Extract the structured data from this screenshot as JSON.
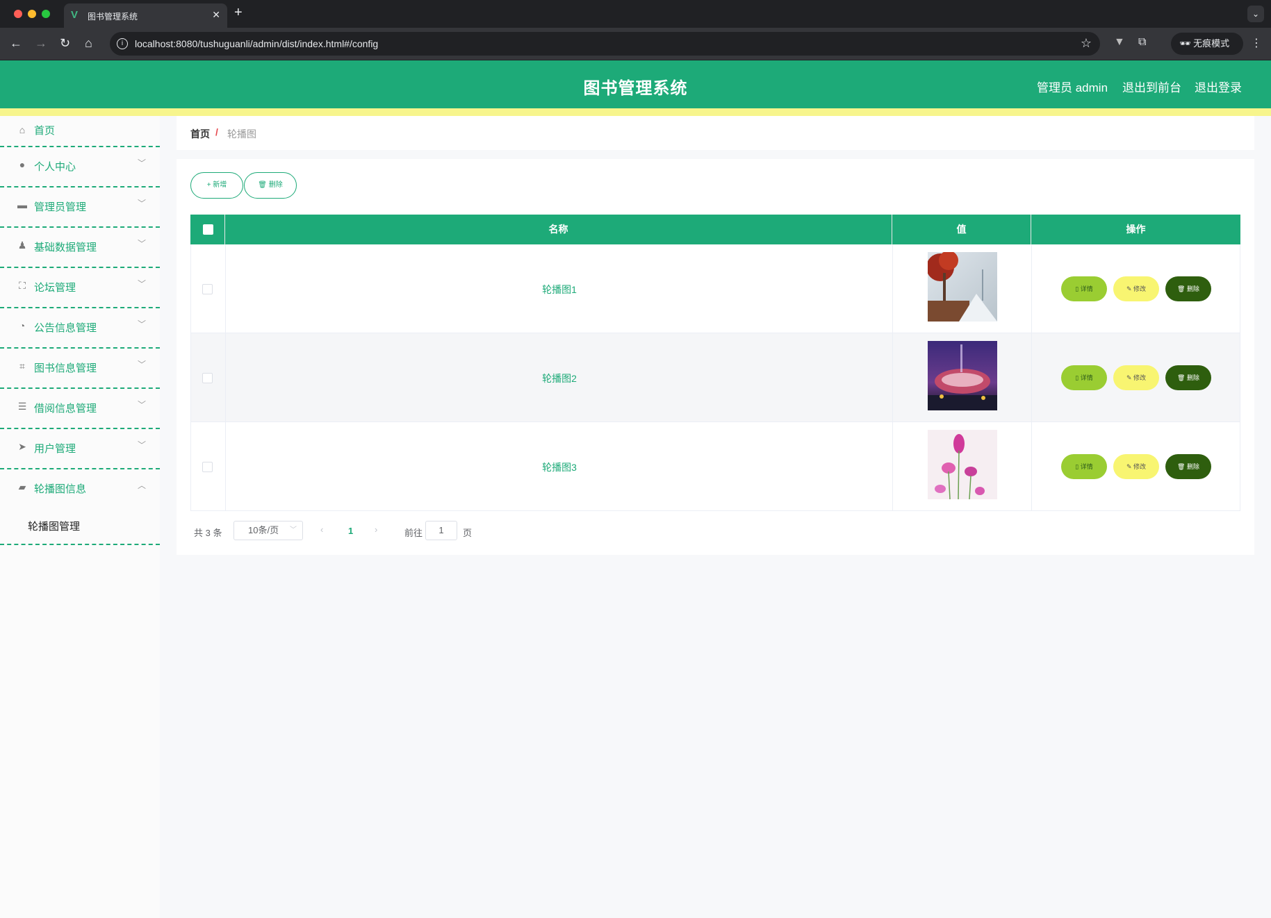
{
  "browser": {
    "tab_title": "图书管理系统",
    "url": "localhost:8080/tushuguanli/admin/dist/index.html#/config",
    "incognito_label": "无痕模式"
  },
  "header": {
    "title": "图书管理系统",
    "user_label": "管理员 admin",
    "front_link": "退出到前台",
    "logout_link": "退出登录",
    "brand_color": "#1daa78",
    "accent_color": "#f7f58c"
  },
  "sidebar": {
    "items": [
      {
        "label": "首页",
        "icon": "home-icon",
        "expandable": false
      },
      {
        "label": "个人中心",
        "icon": "user-icon",
        "expandable": true
      },
      {
        "label": "管理员管理",
        "icon": "monitor-icon",
        "expandable": true
      },
      {
        "label": "基础数据管理",
        "icon": "stamp-icon",
        "expandable": true
      },
      {
        "label": "论坛管理",
        "icon": "fullscreen-icon",
        "expandable": true
      },
      {
        "label": "公告信息管理",
        "icon": "gauge-icon",
        "expandable": true
      },
      {
        "label": "图书信息管理",
        "icon": "crop-icon",
        "expandable": true
      },
      {
        "label": "借阅信息管理",
        "icon": "list-icon",
        "expandable": true
      },
      {
        "label": "用户管理",
        "icon": "send-icon",
        "expandable": true
      },
      {
        "label": "轮播图信息",
        "icon": "ticket-icon",
        "expandable": true,
        "expanded": true
      }
    ],
    "submenu": {
      "label": "轮播图管理"
    }
  },
  "breadcrumb": {
    "home": "首页",
    "separator": "/",
    "current": "轮播图"
  },
  "toolbar": {
    "add_label": "+ 新增",
    "delete_label": "删除"
  },
  "table": {
    "columns": [
      "名称",
      "值",
      "操作"
    ],
    "rows": [
      {
        "name": "轮播图1",
        "image": "carousel-image-1"
      },
      {
        "name": "轮播图2",
        "image": "carousel-image-2"
      },
      {
        "name": "轮播图3",
        "image": "carousel-image-3"
      }
    ],
    "actions": {
      "detail": "详情",
      "edit": "修改",
      "delete": "删除"
    }
  },
  "pagination": {
    "total": "共 3 条",
    "page_size": "10条/页",
    "current_page": "1",
    "goto_label": "前往",
    "goto_value": "1",
    "page_suffix": "页"
  }
}
